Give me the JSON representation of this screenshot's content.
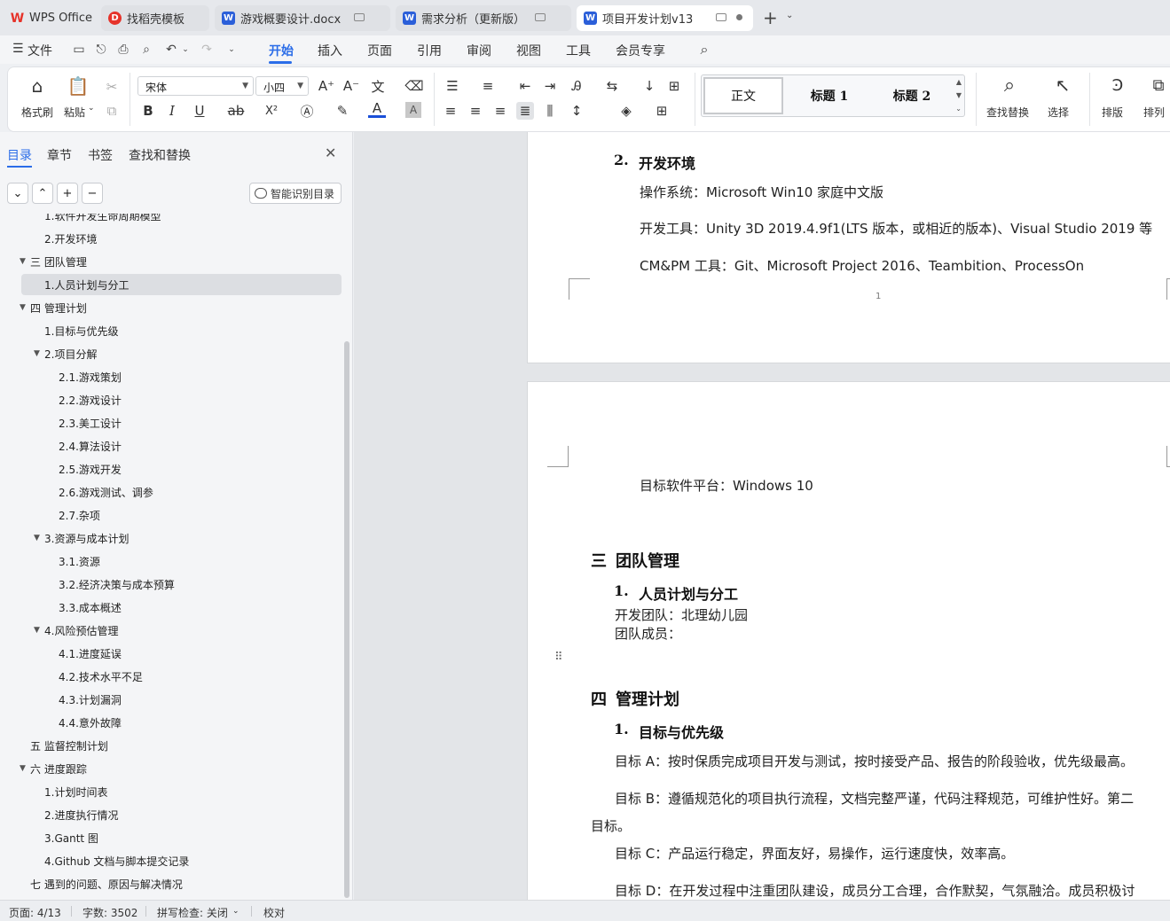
{
  "tabs": [
    {
      "label": "WPS Office",
      "icon": "wps-logo-icon"
    },
    {
      "label": "找稻壳模板",
      "icon": "docer-icon"
    },
    {
      "label": "游戏概要设计.docx",
      "icon": "word-doc-icon"
    },
    {
      "label": "需求分析（更新版）",
      "icon": "word-doc-icon"
    },
    {
      "label": "项目开发计划v13",
      "icon": "word-doc-icon"
    }
  ],
  "menu": {
    "file": "文件",
    "items": [
      "开始",
      "插入",
      "页面",
      "引用",
      "审阅",
      "视图",
      "工具",
      "会员专享"
    ],
    "active": "开始"
  },
  "ribbon": {
    "format_painter": "格式刷",
    "paste": "粘贴",
    "font_name": "宋体",
    "font_size": "小四",
    "styles": [
      "正文",
      "标题 1",
      "标题 2"
    ],
    "find_replace": "查找替换",
    "select": "选择",
    "layout": "排版",
    "arrange": "排列",
    "bold": "B",
    "italic": "I",
    "underline": "U",
    "superscript": "X²",
    "font_color_glyph": "A",
    "char_shade_glyph": "A"
  },
  "sidebar": {
    "tabs": [
      "目录",
      "章节",
      "书签",
      "查找和替换"
    ],
    "smart_button": "智能识别目录",
    "toc": [
      {
        "label": "1.软件开发生命周期模型",
        "level": 1,
        "toggle": false
      },
      {
        "label": "2.开发环境",
        "level": 1,
        "toggle": false
      },
      {
        "label": "三  团队管理",
        "level": 0,
        "toggle": true
      },
      {
        "label": "1.人员计划与分工",
        "level": 1,
        "toggle": false,
        "selected": true
      },
      {
        "label": "四  管理计划",
        "level": 0,
        "toggle": true
      },
      {
        "label": "1.目标与优先级",
        "level": 1,
        "toggle": false
      },
      {
        "label": "2.项目分解",
        "level": 1,
        "toggle": true
      },
      {
        "label": "2.1.游戏策划",
        "level": 2,
        "toggle": false
      },
      {
        "label": "2.2.游戏设计",
        "level": 2,
        "toggle": false
      },
      {
        "label": "2.3.美工设计",
        "level": 2,
        "toggle": false
      },
      {
        "label": "2.4.算法设计",
        "level": 2,
        "toggle": false
      },
      {
        "label": "2.5.游戏开发",
        "level": 2,
        "toggle": false
      },
      {
        "label": "2.6.游戏测试、调参",
        "level": 2,
        "toggle": false
      },
      {
        "label": "2.7.杂项",
        "level": 2,
        "toggle": false
      },
      {
        "label": "3.资源与成本计划",
        "level": 1,
        "toggle": true
      },
      {
        "label": "3.1.资源",
        "level": 2,
        "toggle": false
      },
      {
        "label": "3.2.经济决策与成本预算",
        "level": 2,
        "toggle": false
      },
      {
        "label": "3.3.成本概述",
        "level": 2,
        "toggle": false
      },
      {
        "label": "4.风险预估管理",
        "level": 1,
        "toggle": true
      },
      {
        "label": "4.1.进度延误",
        "level": 2,
        "toggle": false
      },
      {
        "label": "4.2.技术水平不足",
        "level": 2,
        "toggle": false
      },
      {
        "label": "4.3.计划漏洞",
        "level": 2,
        "toggle": false
      },
      {
        "label": "4.4.意外故障",
        "level": 2,
        "toggle": false
      },
      {
        "label": "五  监督控制计划",
        "level": 0,
        "toggle": false
      },
      {
        "label": "六  进度跟踪",
        "level": 0,
        "toggle": true
      },
      {
        "label": "1.计划时间表",
        "level": 1,
        "toggle": false
      },
      {
        "label": "2.进度执行情况",
        "level": 1,
        "toggle": false
      },
      {
        "label": "3.Gantt 图",
        "level": 1,
        "toggle": false
      },
      {
        "label": "4.Github 文档与脚本提交记录",
        "level": 1,
        "toggle": false
      },
      {
        "label": "七  遇到的问题、原因与解决情况",
        "level": 0,
        "toggle": false
      }
    ]
  },
  "document": {
    "page1": {
      "heading_num": "2.",
      "heading": "开发环境",
      "lines": [
        "操作系统：Microsoft Win10  家庭中文版  ",
        "开发工具：Unity 3D 2019.4.9f1(LTS 版本，或相近的版本)、Visual Studio 2019 等",
        "CM&PM 工具：Git、Microsoft Project 2016、Teambition、ProcessOn"
      ],
      "page_number": "1"
    },
    "page2": {
      "target_platform": "目标软件平台：Windows 10",
      "section3_num": "三",
      "section3": "团队管理",
      "s3_sub_num": "1.",
      "s3_sub": "人员计划与分工",
      "team": "开发团队：北理幼儿园",
      "members": "团队成员：",
      "section4_num": "四",
      "section4": "管理计划",
      "s4_sub_num": "1.",
      "s4_sub": "目标与优先级",
      "goal_a": "目标 A：按时保质完成项目开发与测试，按时接受产品、报告的阶段验收，优先级最高。",
      "goal_b1": "目标 B：遵循规范化的项目执行流程，文档完整严谨，代码注释规范，可维护性好。第二",
      "goal_b2": "目标。",
      "goal_c": "目标 C：产品运行稳定，界面友好，易操作，运行速度快，效率高。",
      "goal_d": "目标 D：在开发过程中注重团队建设，成员分工合理，合作默契，气氛融洽。成员积极讨"
    }
  },
  "status": {
    "page": "页面: 4/13",
    "words": "字数: 3502",
    "spell": "拼写检查: 关闭",
    "proof": "校对"
  },
  "colors": {
    "accent": "#2b6de8",
    "wps_red": "#e6332a",
    "word_blue": "#2b5fd9"
  }
}
